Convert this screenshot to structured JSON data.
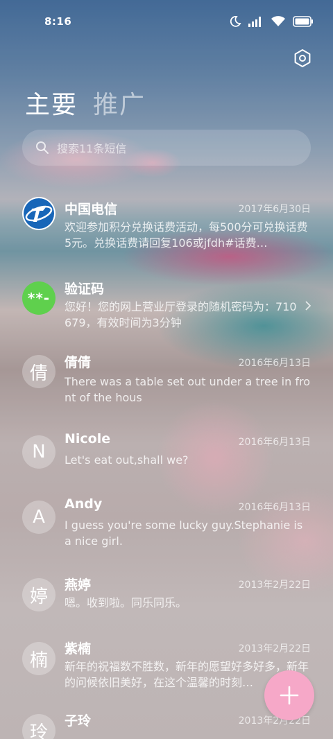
{
  "status_bar": {
    "time": "8:16"
  },
  "tabs": [
    {
      "label": "主要",
      "active": true
    },
    {
      "label": "推广",
      "active": false
    }
  ],
  "search": {
    "placeholder": "搜索11条短信"
  },
  "conversations": [
    {
      "name": "中国电信",
      "date": "2017年6月30日",
      "preview": "欢迎参加积分兑换话费活动，每500分可兑换话费5元。兑换话费请回复106或jfdh#话费…",
      "avatar": "telecom-logo"
    },
    {
      "name": "验证码",
      "date": "",
      "preview": "您好！您的网上营业厅登录的随机密码为：710679，有效时间为3分钟",
      "avatar_text": "**-"
    },
    {
      "name": "倩倩",
      "date": "2016年6月13日",
      "preview": "There was a table set out under a tree in front of the hous",
      "avatar_text": "倩"
    },
    {
      "name": "Nicole",
      "date": "2016年6月13日",
      "preview": "Let's eat out,shall we?",
      "avatar_text": "N"
    },
    {
      "name": "Andy",
      "date": "2016年6月13日",
      "preview": "I guess you're some lucky guy.Stephanie is a nice girl.",
      "avatar_text": "A"
    },
    {
      "name": "燕婷",
      "date": "2013年2月22日",
      "preview": "嗯。收到啦。同乐同乐。",
      "avatar_text": "婷"
    },
    {
      "name": "紫楠",
      "date": "2013年2月22日",
      "preview": "新年的祝福数不胜数，新年的愿望好多好多，新年的问候依旧美好，在这个温馨的时刻…",
      "avatar_text": "楠"
    },
    {
      "name": "子玲",
      "date": "2013年2月22日",
      "preview": "",
      "avatar_text": "玲"
    }
  ],
  "colors": {
    "fab": "#f6a8c8",
    "verification_avatar": "#5fd04d",
    "telecom_blue": "#1866b8"
  },
  "icons": [
    "moon-icon",
    "signal-icon",
    "wifi-icon",
    "battery-icon",
    "settings-icon",
    "search-icon",
    "chevron-right-icon",
    "plus-icon"
  ]
}
